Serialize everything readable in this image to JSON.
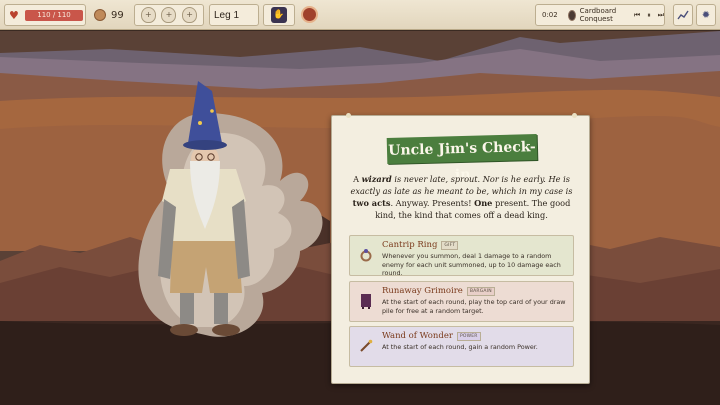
{
  "topbar": {
    "hp": "110 / 110",
    "gold": "99",
    "potion_glyph": "+",
    "leg": "Leg 1",
    "timer": "0:02",
    "run_name": "Cardboard Conquest",
    "controls": [
      "⏮",
      "⏸",
      "⏭"
    ]
  },
  "event": {
    "title": "Uncle Jim's Check-in",
    "intro_html_parts": {
      "p1": "A ",
      "p2": "wizard",
      "p3": " is never late, sprout. Nor is he early. He is exactly as late as he meant to be, which in my case is ",
      "p4": "two acts",
      "p5": ". Anyway. Presents! ",
      "p6": "One",
      "p7": " present. The good kind, the kind that comes off a dead king."
    },
    "options": [
      {
        "title": "Cantrip Ring",
        "tag": "GIFT",
        "desc": "Whenever you summon, deal 1 damage to a random enemy for each unit summoned, up to 10 damage each round.",
        "bg": "#e4e6cf",
        "icon": "ring-icon"
      },
      {
        "title": "Runaway Grimoire",
        "tag": "BARGAIN",
        "desc": "At the start of each round, play the top card of your draw pile for free at a random target.",
        "bg": "#eddcd3",
        "icon": "book-icon"
      },
      {
        "title": "Wand of Wonder",
        "tag": "POWER",
        "desc": "At the start of each round, gain a random Power.",
        "bg": "#e2dce9",
        "icon": "wand-icon"
      }
    ]
  },
  "colors": {
    "banner": "#4b7e3e",
    "hp_bar": "#c9564a",
    "option_title": "#7a3a1c"
  }
}
